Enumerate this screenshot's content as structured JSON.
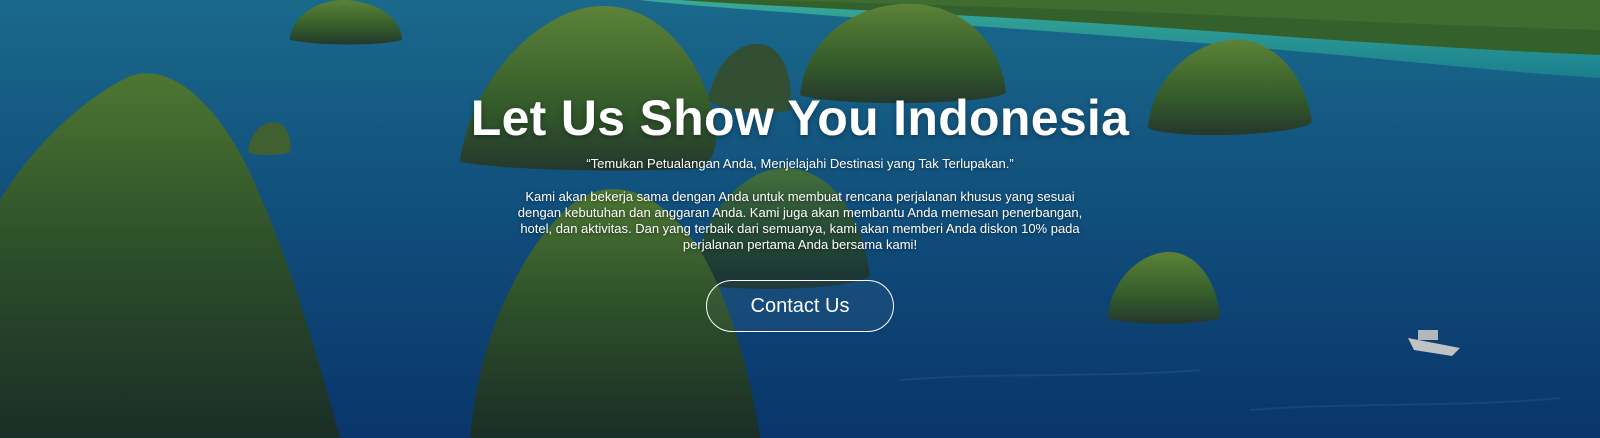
{
  "hero": {
    "title": "Let Us Show You Indonesia",
    "tagline": "“Temukan Petualangan Anda, Menjelajahi Destinasi yang Tak Terlupakan.”",
    "description": "Kami akan bekerja sama dengan Anda untuk membuat rencana perjalanan khusus yang sesuai dengan kebutuhan dan anggaran Anda. Kami juga akan membantu Anda memesan penerbangan, hotel, dan aktivitas. Dan yang terbaik dari semuanya, kami akan memberi Anda diskon 10% pada perjalanan pertama Anda bersama kami!",
    "cta_label": "Contact Us",
    "background_scene": "aerial-islands-sea",
    "colors": {
      "sea_deep": "#0c3f7c",
      "sea_mid": "#13588a",
      "lagoon": "#2fbfa6",
      "island_green": "#4f7d2c",
      "rock": "#3d4a3c",
      "text": "#ffffff"
    }
  }
}
